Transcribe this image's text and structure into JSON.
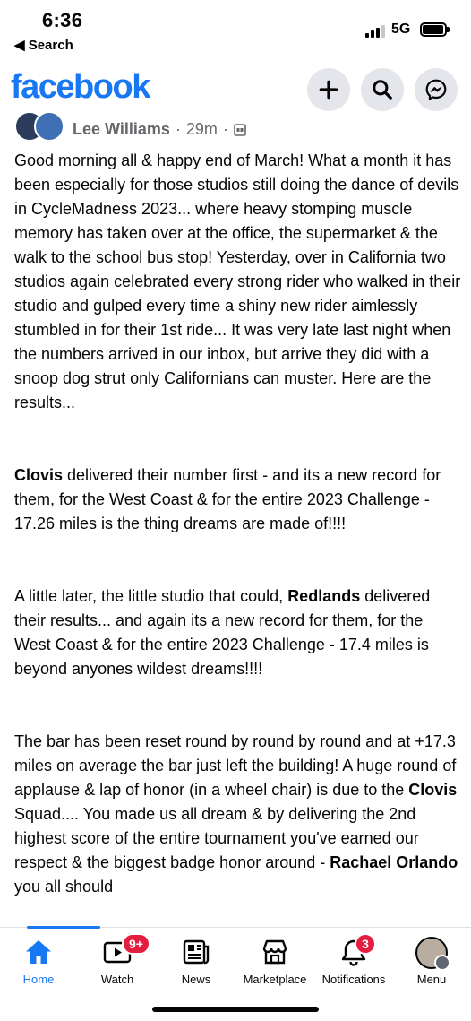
{
  "status_bar": {
    "time": "6:36",
    "back_label": "◀ Search",
    "network": "5G"
  },
  "header": {
    "logo": "facebook",
    "buttons": [
      {
        "name": "create",
        "icon": "plus-icon"
      },
      {
        "name": "search",
        "icon": "search-icon"
      },
      {
        "name": "messenger",
        "icon": "messenger-icon"
      }
    ]
  },
  "post": {
    "author": "Lee Williams",
    "separator": "·",
    "time": "29m",
    "audience_icon": "group-icon",
    "paragraphs": [
      {
        "text": "Good morning all & happy end of March! What a month it has been especially for those studios still doing the dance of devils in CycleMadness 2023... where heavy stomping muscle memory has taken over at the office, the supermarket & the walk to the school bus stop! Yesterday, over in California two studios again celebrated every strong rider who walked in their studio and gulped every time a shiny new rider aimlessly stumbled in for their 1st ride... It was very late last night when the numbers arrived in our inbox, but arrive they did with a snoop dog strut only Californians can muster. Here are the results..."
      },
      {
        "bold": "Clovis",
        "text": " delivered their number first - and its a new record for them, for the West Coast & for the entire 2023 Challenge - 17.26 miles is the thing dreams are made of!!!!"
      },
      {
        "pre": "A little later, the little studio that could, ",
        "bold": "Redlands",
        "text": " delivered their results... and again its a new record for them, for the West Coast & for the entire 2023 Challenge - 17.4 miles is beyond anyones wildest dreams!!!!"
      },
      {
        "pre": "The bar has been reset round by round by round and at +17.3 miles on average the bar just left the building! A huge round of applause & lap of honor (in a wheel chair) is due to the ",
        "bold": "Clovis",
        "text": " Squad.... You made us all dream & by delivering the 2nd highest score of the entire tournament you've earned our respect &  the biggest badge honor around - ",
        "bold2": "Rachael Orlando",
        "text2": " you all should"
      }
    ]
  },
  "tabs": [
    {
      "label": "Home",
      "icon": "home-icon",
      "active": true
    },
    {
      "label": "Watch",
      "icon": "watch-icon",
      "badge": "9+"
    },
    {
      "label": "News",
      "icon": "news-icon"
    },
    {
      "label": "Marketplace",
      "icon": "marketplace-icon"
    },
    {
      "label": "Notifications",
      "icon": "bell-icon",
      "badge": "3"
    },
    {
      "label": "Menu",
      "icon": "menu-avatar-icon"
    }
  ],
  "colors": {
    "brand": "#1877f2",
    "badge": "#e41e3f",
    "secondary_text": "#65676b"
  }
}
